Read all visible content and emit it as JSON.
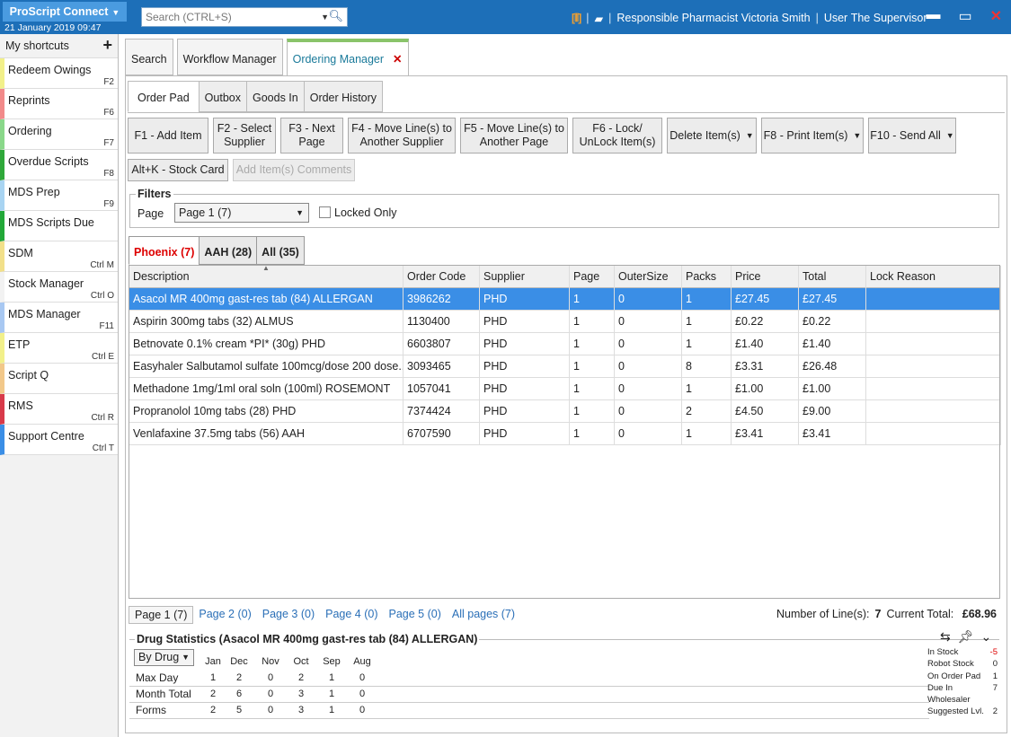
{
  "app": {
    "brand": "ProScript Connect",
    "datetime": "21 January 2019 09:47",
    "search_placeholder": "Search (CTRL+S)",
    "pharmacist_label": "Responsible Pharmacist",
    "pharmacist_name": "Victoria Smith",
    "user_label": "User",
    "user_name": "The Supervisor"
  },
  "sidebar": {
    "title": "My shortcuts",
    "items": [
      {
        "label": "Redeem Owings",
        "key": "F2",
        "color": "#f2f08a"
      },
      {
        "label": "Reprints",
        "key": "F6",
        "color": "#f28a8a"
      },
      {
        "label": "Ordering",
        "key": "F7",
        "color": "#8ad88a"
      },
      {
        "label": "Overdue Scripts",
        "key": "F8",
        "color": "#2fa83a"
      },
      {
        "label": "MDS Prep",
        "key": "F9",
        "color": "#a8d4f2"
      },
      {
        "label": "MDS Scripts Due",
        "key": "",
        "color": "#22a838"
      },
      {
        "label": "SDM",
        "key": "Ctrl M",
        "color": "#f2e08a"
      },
      {
        "label": "Stock Manager",
        "key": "Ctrl O",
        "color": "#f2f2f2"
      },
      {
        "label": "MDS Manager",
        "key": "F11",
        "color": "#a8c8f2"
      },
      {
        "label": "ETP",
        "key": "Ctrl E",
        "color": "#f2f08a"
      },
      {
        "label": "Script Q",
        "key": "",
        "color": "#f2c88a"
      },
      {
        "label": "RMS",
        "key": "Ctrl R",
        "color": "#d83a4a"
      },
      {
        "label": "Support Centre",
        "key": "Ctrl T",
        "color": "#3a8ee6"
      }
    ]
  },
  "main_tabs": [
    {
      "label": "Search"
    },
    {
      "label": "Workflow Manager"
    },
    {
      "label": "Ordering Manager"
    }
  ],
  "sub_tabs": [
    {
      "label": "Order Pad"
    },
    {
      "label": "Outbox"
    },
    {
      "label": "Goods In"
    },
    {
      "label": "Order History"
    }
  ],
  "buttons": {
    "add_item": "F1 - Add Item",
    "select_supplier": "F2 - Select Supplier",
    "next_page": "F3 - Next Page",
    "move_lines": "F4 - Move Line(s) to Another Supplier",
    "move_page": "F5 - Move Line(s) to Another Page",
    "lock": "F6 - Lock/ UnLock Item(s)",
    "delete": "Delete Item(s)",
    "print": "F8 - Print Item(s)",
    "send_all": "F10 - Send All",
    "stock_card": "Alt+K - Stock Card",
    "comments": "Add Item(s) Comments"
  },
  "filters": {
    "title": "Filters",
    "page_label": "Page",
    "page_value": "Page 1 (7)",
    "locked_only": "Locked Only"
  },
  "supplier_tabs": [
    {
      "label": "Phoenix (7)"
    },
    {
      "label": "AAH (28)"
    },
    {
      "label": "All (35)"
    }
  ],
  "table": {
    "headers": [
      "Description",
      "Order Code",
      "Supplier",
      "Page",
      "OuterSize",
      "Packs",
      "Price",
      "Total",
      "Lock Reason"
    ],
    "rows": [
      [
        "Asacol MR 400mg gast-res tab (84) ALLERGAN",
        "3986262",
        "PHD",
        "1",
        "0",
        "1",
        "£27.45",
        "£27.45",
        ""
      ],
      [
        "Aspirin 300mg tabs (32) ALMUS",
        "1130400",
        "PHD",
        "1",
        "0",
        "1",
        "£0.22",
        "£0.22",
        ""
      ],
      [
        "Betnovate 0.1% cream *PI* (30g) PHD",
        "6603807",
        "PHD",
        "1",
        "0",
        "1",
        "£1.40",
        "£1.40",
        ""
      ],
      [
        "Easyhaler Salbutamol sulfate 100mcg/dose 200 dose...",
        "3093465",
        "PHD",
        "1",
        "0",
        "8",
        "£3.31",
        "£26.48",
        ""
      ],
      [
        "Methadone 1mg/1ml oral soln (100ml) ROSEMONT",
        "1057041",
        "PHD",
        "1",
        "0",
        "1",
        "£1.00",
        "£1.00",
        ""
      ],
      [
        "Propranolol 10mg tabs (28) PHD",
        "7374424",
        "PHD",
        "1",
        "0",
        "2",
        "£4.50",
        "£9.00",
        ""
      ],
      [
        "Venlafaxine 37.5mg tabs (56) AAH",
        "6707590",
        "PHD",
        "1",
        "0",
        "1",
        "£3.41",
        "£3.41",
        ""
      ]
    ]
  },
  "pager": [
    "Page 1 (7)",
    "Page 2 (0)",
    "Page 3 (0)",
    "Page 4 (0)",
    "Page 5 (0)",
    "All pages (7)"
  ],
  "summary": {
    "lines_label": "Number of Line(s):",
    "lines": "7",
    "total_label": "Current Total:",
    "total": "£68.96"
  },
  "stats": {
    "title": "Drug Statistics (Asacol MR 400mg gast-res tab (84) ALLERGAN)",
    "mode": "By Drug",
    "months": [
      "Jan",
      "Dec",
      "Nov",
      "Oct",
      "Sep",
      "Aug"
    ],
    "rows": [
      {
        "label": "Max Day",
        "values": [
          "1",
          "2",
          "0",
          "2",
          "1",
          "0"
        ]
      },
      {
        "label": "Month Total",
        "values": [
          "2",
          "6",
          "0",
          "3",
          "1",
          "0"
        ]
      },
      {
        "label": "Forms",
        "values": [
          "2",
          "5",
          "0",
          "3",
          "1",
          "0"
        ]
      }
    ],
    "side": [
      {
        "label": "In Stock",
        "value": "-5"
      },
      {
        "label": "Robot Stock",
        "value": "0"
      },
      {
        "label": "On Order Pad",
        "value": "1"
      },
      {
        "label": "Due In",
        "value": "7"
      },
      {
        "label": "Wholesaler",
        "value": ""
      },
      {
        "label": "Suggested Lvl.",
        "value": "2"
      }
    ]
  }
}
